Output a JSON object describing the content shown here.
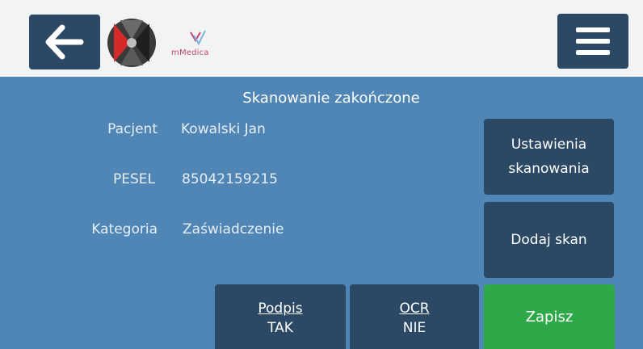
{
  "header": {
    "back_icon": "arrow-left-icon",
    "menu_icon": "hamburger-menu-icon",
    "brand_text": "mMedica"
  },
  "status": {
    "title": "Skanowanie zakończone"
  },
  "info": {
    "patient_label": "Pacjent",
    "patient_value": "Kowalski Jan",
    "pesel_label": "PESEL",
    "pesel_value": "85042159215",
    "category_label": "Kategoria",
    "category_value": "Zaświadczenie"
  },
  "actions": {
    "settings_line1": "Ustawienia",
    "settings_line2": "skanowania",
    "add_scan": "Dodaj skan",
    "signature_label": "Podpis",
    "signature_value": "TAK",
    "ocr_label": "OCR",
    "ocr_value": "NIE",
    "save": "Zapisz"
  },
  "colors": {
    "accent_dark": "#2b4864",
    "panel_blue": "#4f86b6",
    "save_green": "#2ea94a",
    "topbar_bg": "#f2f3f5"
  }
}
